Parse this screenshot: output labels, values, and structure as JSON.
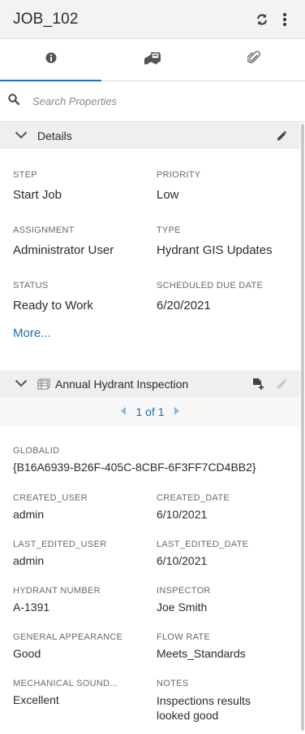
{
  "header": {
    "title": "JOB_102"
  },
  "search": {
    "placeholder": "Search Properties"
  },
  "details": {
    "title": "Details",
    "fields": [
      {
        "label": "STEP",
        "value": "Start Job"
      },
      {
        "label": "PRIORITY",
        "value": "Low"
      },
      {
        "label": "ASSIGNMENT",
        "value": "Administrator User"
      },
      {
        "label": "TYPE",
        "value": "Hydrant GIS Updates"
      },
      {
        "label": "STATUS",
        "value": "Ready to Work"
      },
      {
        "label": "SCHEDULED DUE DATE",
        "value": "6/20/2021"
      }
    ],
    "more_label": "More..."
  },
  "inspection": {
    "title": "Annual Hydrant Inspection",
    "pager": "1 of 1",
    "globalid_label": "GLOBALID",
    "globalid_value": "{B16A6939-B26F-405C-8CBF-6F3FF7CD4BB2}",
    "fields": [
      {
        "label": "CREATED_USER",
        "value": "admin"
      },
      {
        "label": "CREATED_DATE",
        "value": "6/10/2021"
      },
      {
        "label": "LAST_EDITED_USER",
        "value": "admin"
      },
      {
        "label": "LAST_EDITED_DATE",
        "value": "6/10/2021"
      },
      {
        "label": "HYDRANT NUMBER",
        "value": "A-1391"
      },
      {
        "label": "INSPECTOR",
        "value": "Joe Smith"
      },
      {
        "label": "GENERAL APPEARANCE",
        "value": "Good"
      },
      {
        "label": "FLOW RATE",
        "value": "Meets_Standards"
      },
      {
        "label": "MECHANICAL SOUND...",
        "value": "Excellent"
      },
      {
        "label": "NOTES",
        "value": "Inspections results looked good"
      }
    ]
  },
  "colors": {
    "accent": "#1d6fa6",
    "header_bg": "#f3f3f3",
    "section_bg": "#efefef"
  },
  "icons": [
    "refresh-icon",
    "more-vertical-icon",
    "info-icon",
    "map-icon",
    "paperclip-icon",
    "search-icon",
    "chevron-down-icon",
    "pencil-icon",
    "table-icon",
    "add-record-icon",
    "chevron-left-icon",
    "chevron-right-icon"
  ]
}
